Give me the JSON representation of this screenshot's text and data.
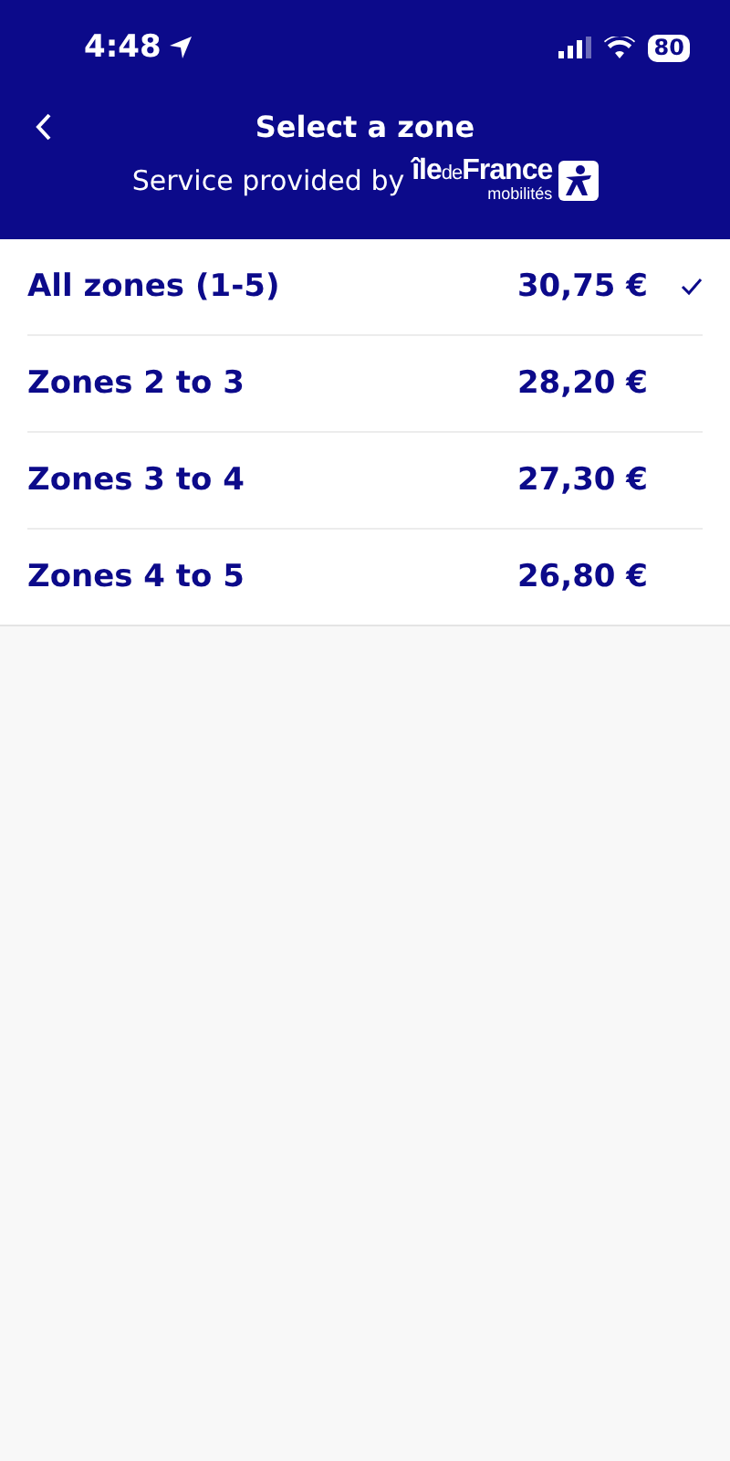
{
  "status_bar": {
    "time": "4:48",
    "battery": "80"
  },
  "header": {
    "title": "Select a zone",
    "provided_by": "Service provided by",
    "logo": {
      "part_1": "île",
      "part_2": "de",
      "part_3": "France",
      "subtitle": "mobilités"
    }
  },
  "zones": [
    {
      "name": "All zones (1-5)",
      "price": "30,75 €",
      "selected": true
    },
    {
      "name": "Zones 2 to 3",
      "price": "28,20 €",
      "selected": false
    },
    {
      "name": "Zones 3 to 4",
      "price": "27,30 €",
      "selected": false
    },
    {
      "name": "Zones 4 to 5",
      "price": "26,80 €",
      "selected": false
    }
  ]
}
